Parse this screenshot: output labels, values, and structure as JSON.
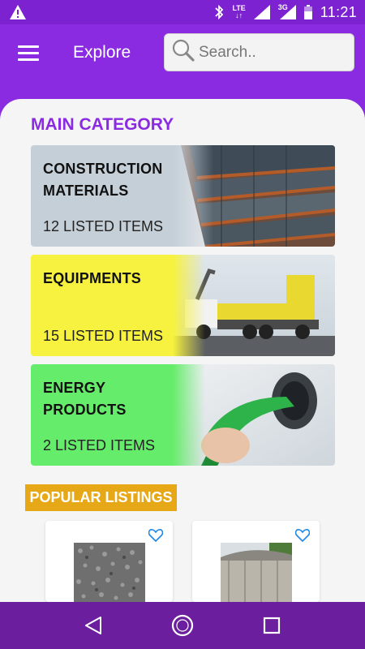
{
  "status_bar": {
    "time": "11:21",
    "network_label": "LTE",
    "network_label_2": "3G",
    "icons": [
      "warning-icon",
      "bluetooth-icon",
      "signal-icon",
      "battery-icon"
    ]
  },
  "app_bar": {
    "title": "Explore",
    "search_placeholder": "Search.."
  },
  "main": {
    "section_title": "MAIN CATEGORY",
    "categories": [
      {
        "name_line1": "CONSTRUCTION",
        "name_line2": "MATERIALS",
        "count": "12 LISTED ITEMS",
        "color": "#c5cfd8"
      },
      {
        "name_line1": "EQUIPMENTS",
        "name_line2": "",
        "count": "15 LISTED ITEMS",
        "color": "#f7f23f"
      },
      {
        "name_line1": "ENERGY",
        "name_line2": "PRODUCTS",
        "count": "2 LISTED ITEMS",
        "color": "#66ec6b"
      }
    ],
    "popular_title": "POPULAR LISTINGS"
  },
  "colors": {
    "accent": "#8a2be2",
    "badge": "#e6a817",
    "nav": "#6b1f9e"
  }
}
